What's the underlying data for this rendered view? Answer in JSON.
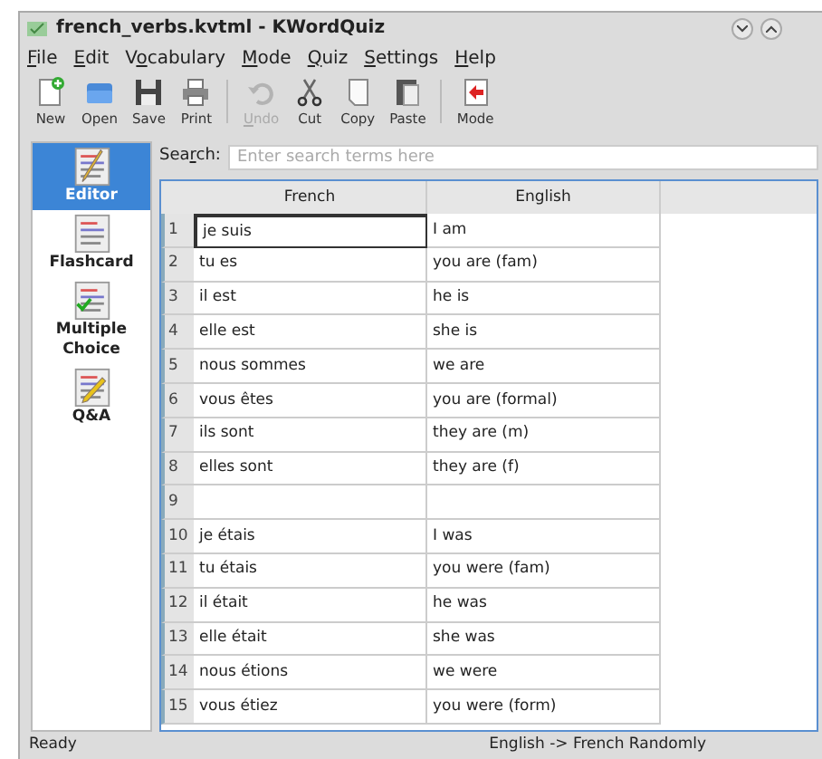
{
  "window": {
    "title": "french_verbs.kvtml - KWordQuiz"
  },
  "menu": [
    {
      "key": "F",
      "after": "ile"
    },
    {
      "key": "E",
      "after": "dit"
    },
    {
      "before": "V",
      "key": "o",
      "after": "cabulary"
    },
    {
      "key": "M",
      "after": "ode"
    },
    {
      "key": "Q",
      "after": "uiz"
    },
    {
      "key": "S",
      "after": "ettings"
    },
    {
      "key": "H",
      "after": "elp"
    }
  ],
  "toolbar": [
    {
      "kind": "button",
      "before": "New",
      "disabled": false
    },
    {
      "kind": "button",
      "before": "Open",
      "disabled": false
    },
    {
      "kind": "button",
      "before": "Save",
      "disabled": false
    },
    {
      "kind": "button",
      "before": "Print",
      "disabled": false
    },
    {
      "kind": "separator"
    },
    {
      "kind": "button",
      "key": "U",
      "after": "ndo",
      "disabled": true
    },
    {
      "kind": "button",
      "before": "Cut",
      "disabled": false
    },
    {
      "kind": "button",
      "before": "Copy",
      "disabled": false
    },
    {
      "kind": "button",
      "before": "Paste",
      "disabled": false
    },
    {
      "kind": "separator"
    },
    {
      "kind": "button",
      "before": "Mode",
      "disabled": false
    }
  ],
  "sidebar": {
    "items": [
      {
        "label": "Editor",
        "selected": true
      },
      {
        "label": "Flashcard",
        "selected": false
      },
      {
        "label": "Multiple Choice",
        "selected": false
      },
      {
        "label": "Q&A",
        "selected": false
      }
    ]
  },
  "search": {
    "label": {
      "before": "Sea",
      "key": "r",
      "after": "ch:"
    },
    "placeholder": "Enter search terms here"
  },
  "table": {
    "columns": [
      "French",
      "English"
    ],
    "rows": [
      {
        "number": "1",
        "french": "je suis",
        "english": "I am",
        "focused": true
      },
      {
        "number": "2",
        "french": "tu es",
        "english": "you are (fam)",
        "focused": false
      },
      {
        "number": "3",
        "french": "il est",
        "english": "he is",
        "focused": false
      },
      {
        "number": "4",
        "french": "elle est",
        "english": "she is",
        "focused": false
      },
      {
        "number": "5",
        "french": "nous sommes",
        "english": "we are",
        "focused": false
      },
      {
        "number": "6",
        "french": "vous êtes",
        "english": "you are (formal)",
        "focused": false
      },
      {
        "number": "7",
        "french": "ils sont",
        "english": "they are (m)",
        "focused": false
      },
      {
        "number": "8",
        "french": "elles sont",
        "english": "they are (f)",
        "focused": false
      },
      {
        "number": "9",
        "focused": false
      },
      {
        "number": "10",
        "french": "je étais",
        "english": "I was",
        "focused": false
      },
      {
        "number": "11",
        "french": "tu étais",
        "english": "you were (fam)",
        "focused": false
      },
      {
        "number": "12",
        "french": "il était",
        "english": "he was",
        "focused": false
      },
      {
        "number": "13",
        "french": "elle était",
        "english": "she was",
        "focused": false
      },
      {
        "number": "14",
        "french": "nous étions",
        "english": "we were",
        "focused": false
      },
      {
        "number": "15",
        "french": "vous étiez",
        "english": "you were (form)",
        "focused": false
      }
    ]
  },
  "status_bar": {
    "left": "Ready",
    "right": "English -> French Randomly"
  }
}
